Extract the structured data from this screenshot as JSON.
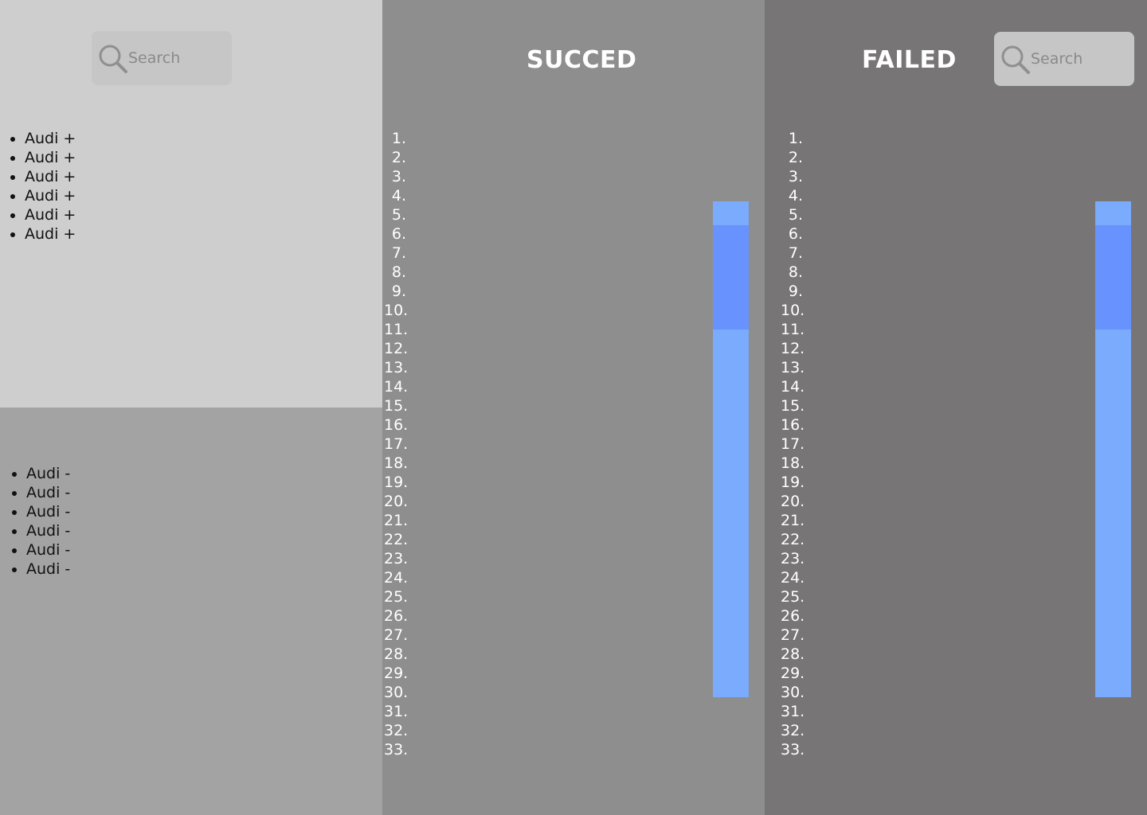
{
  "search": {
    "placeholder": "Search"
  },
  "positive_list": {
    "items": [
      "Audi +",
      "Audi +",
      "Audi +",
      "Audi +",
      "Audi +",
      "Audi +"
    ]
  },
  "negative_list": {
    "items": [
      "Audi -",
      "Audi -",
      "Audi -",
      "Audi -",
      "Audi -",
      "Audi -"
    ]
  },
  "succeed": {
    "title": "SUCCED",
    "numbers": [
      "1.",
      "2.",
      "3.",
      "4.",
      "5.",
      "6.",
      "7.",
      "8.",
      "9.",
      "10.",
      "11.",
      "12.",
      "13.",
      "14.",
      "15.",
      "16.",
      "17.",
      "18.",
      "19.",
      "20.",
      "21.",
      "22.",
      "23.",
      "24.",
      "25.",
      "26.",
      "27.",
      "28.",
      "29.",
      "30.",
      "31.",
      "32.",
      "33."
    ]
  },
  "failed": {
    "title": "FAILED",
    "numbers": [
      "1.",
      "2.",
      "3.",
      "4.",
      "5.",
      "6.",
      "7.",
      "8.",
      "9.",
      "10.",
      "11.",
      "12.",
      "13.",
      "14.",
      "15.",
      "16.",
      "17.",
      "18.",
      "19.",
      "20.",
      "21.",
      "22.",
      "23.",
      "24.",
      "25.",
      "26.",
      "27.",
      "28.",
      "29.",
      "30.",
      "31.",
      "32.",
      "33."
    ]
  },
  "colors": {
    "left_top_bg": "#cecece",
    "left_bottom_bg": "#a3a3a3",
    "succeed_bg": "#8e8e8e",
    "failed_bg": "#777576",
    "scrollbar_track": "#7aabfd",
    "scrollbar_thumb": "#6893ff"
  },
  "icons": {
    "search": "magnifier-icon"
  }
}
